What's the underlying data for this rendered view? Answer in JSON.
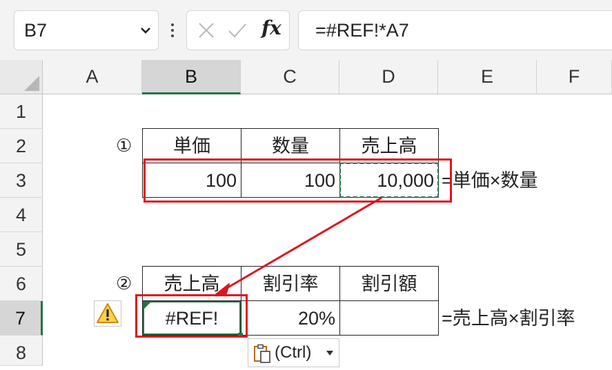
{
  "formula_bar": {
    "name_box": "B7",
    "formula": "=#REF!*A7"
  },
  "columns": [
    "A",
    "B",
    "C",
    "D",
    "E",
    "F"
  ],
  "rows": [
    "1",
    "2",
    "3",
    "4",
    "5",
    "6",
    "7",
    "8"
  ],
  "table1": {
    "marker": "①",
    "headers": [
      "単価",
      "数量",
      "売上高"
    ],
    "values": [
      "100",
      "100",
      "10,000"
    ],
    "note": "=単価×数量"
  },
  "table2": {
    "marker": "②",
    "headers": [
      "売上高",
      "割引率",
      "割引額"
    ],
    "values": [
      "#REF!",
      "20%",
      ""
    ],
    "note": "=売上高×割引率"
  },
  "paste_options": {
    "label": "(Ctrl)"
  },
  "colors": {
    "accent_green": "#217346",
    "highlight_red": "#e0141e"
  },
  "icons": [
    "chevron-down-icon",
    "more-icon",
    "cancel-icon",
    "enter-icon",
    "function-icon",
    "warning-icon",
    "paste-icon",
    "dropdown-arrow-icon"
  ]
}
